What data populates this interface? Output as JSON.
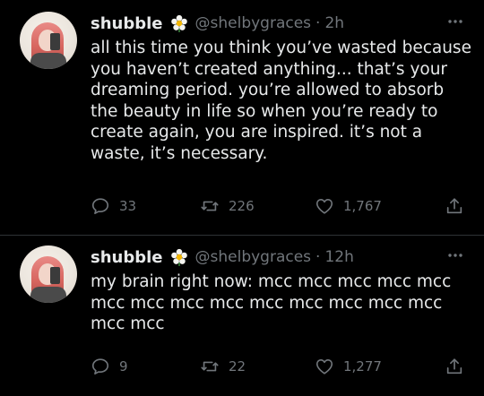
{
  "tweets": [
    {
      "name": "shubble",
      "handle": "@shelbygraces",
      "separator": "·",
      "time": "2h",
      "text": "all this time you think you’ve wasted because you haven’t created anything... that’s your dreaming period. you’re allowed to absorb the beauty in life so when you’re ready to create again, you are inspired. it’s not a waste, it’s necessary.",
      "replies": "33",
      "retweets": "226",
      "likes": "1,767"
    },
    {
      "name": "shubble",
      "handle": "@shelbygraces",
      "separator": "·",
      "time": "12h",
      "text": "my brain right now: mcc mcc mcc mcc mcc mcc mcc mcc mcc mcc mcc mcc mcc mcc mcc mcc",
      "replies": "9",
      "retweets": "22",
      "likes": "1,277"
    }
  ],
  "icons": {
    "badge": "flower-icon",
    "more": "more-icon",
    "reply": "reply-icon",
    "retweet": "retweet-icon",
    "like": "heart-icon",
    "share": "share-icon"
  },
  "colors": {
    "background": "#000000",
    "text": "#e7e9ea",
    "muted": "#71767b",
    "divider": "#2f3336"
  }
}
